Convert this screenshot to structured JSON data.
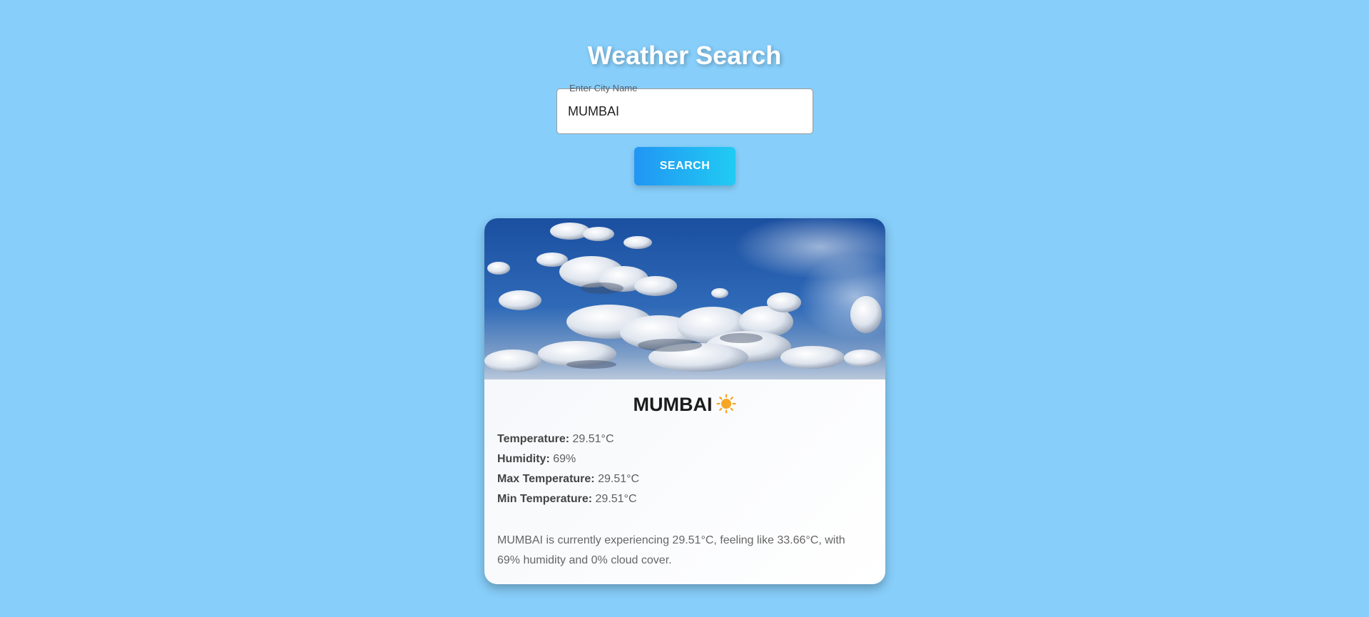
{
  "header": {
    "title": "Weather Search"
  },
  "search": {
    "label": "Enter City Name",
    "value": "MUMBAI",
    "button_label": "SEARCH"
  },
  "card": {
    "image": "clouds-sky-photo",
    "city": "MUMBAI",
    "condition_icon": "sun-icon",
    "details": [
      {
        "label": "Temperature:",
        "value": "29.51°C"
      },
      {
        "label": "Humidity:",
        "value": "69%"
      },
      {
        "label": "Max Temperature:",
        "value": "29.51°C"
      },
      {
        "label": "Min Temperature:",
        "value": "29.51°C"
      }
    ],
    "summary": "MUMBAI is currently experiencing 29.51°C, feeling like 33.66°C, with 69% humidity and 0% cloud cover."
  },
  "colors": {
    "background": "#87cefa",
    "button_gradient_start": "#2196f3",
    "button_gradient_end": "#21cbf3",
    "sun": "#f5a623"
  }
}
